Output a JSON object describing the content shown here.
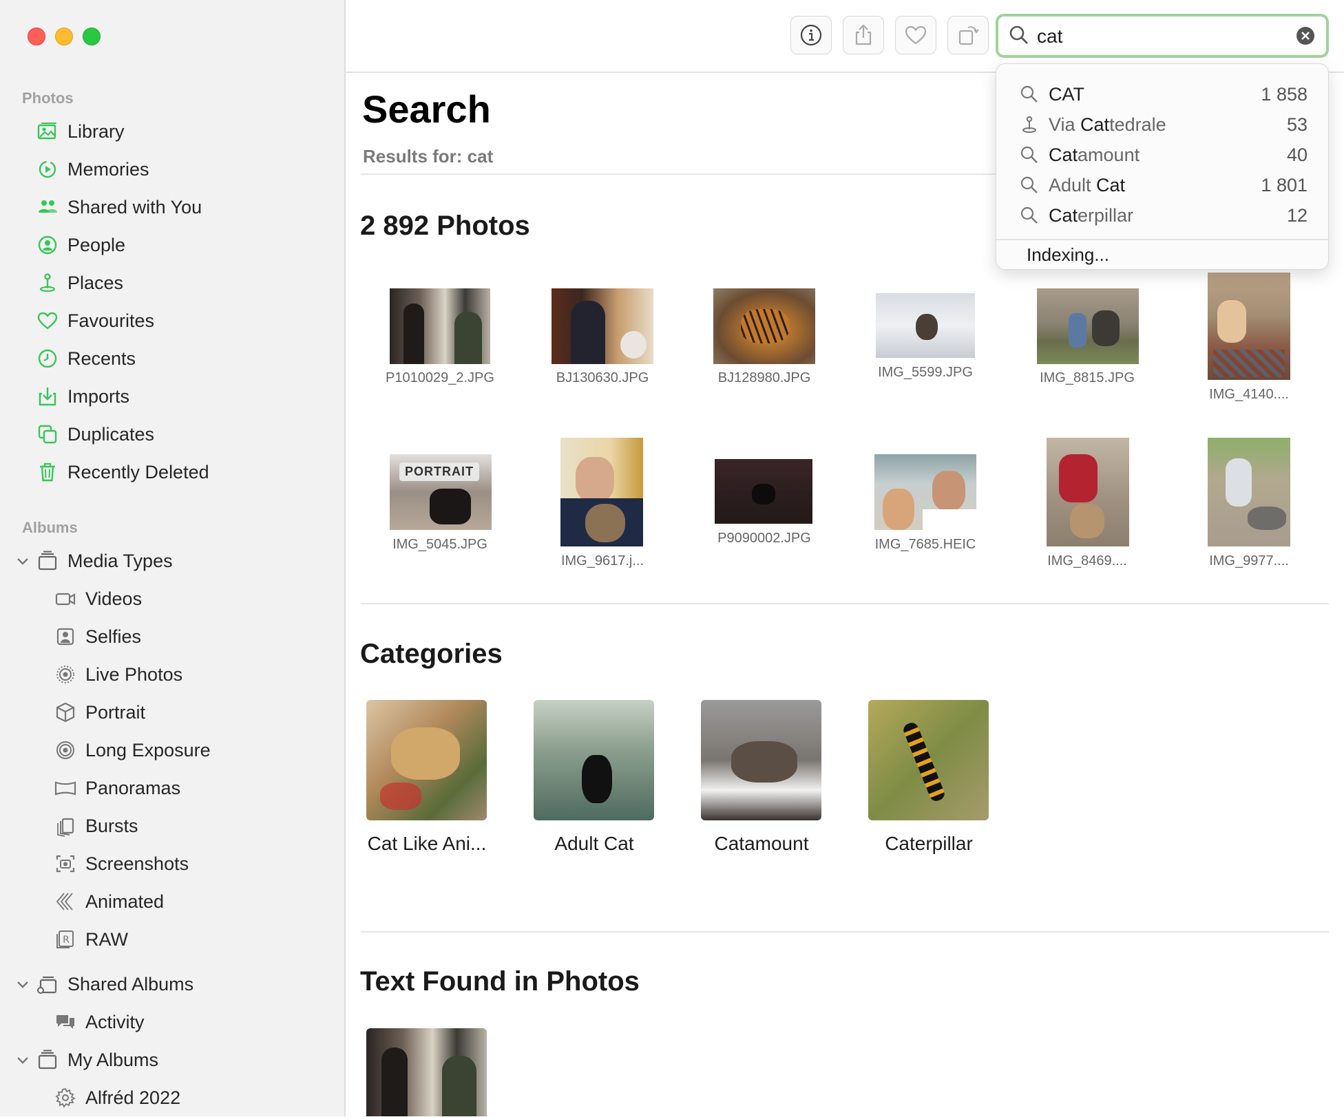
{
  "accent": "#34c759",
  "search_ring": "#9fd49a",
  "sidebar": {
    "section_photos": "Photos",
    "photos_items": [
      {
        "label": "Library",
        "icon": "library-icon"
      },
      {
        "label": "Memories",
        "icon": "memories-icon"
      },
      {
        "label": "Shared with You",
        "icon": "shared-with-you-icon"
      },
      {
        "label": "People",
        "icon": "people-icon"
      },
      {
        "label": "Places",
        "icon": "places-icon"
      },
      {
        "label": "Favourites",
        "icon": "heart-icon"
      },
      {
        "label": "Recents",
        "icon": "clock-icon"
      },
      {
        "label": "Imports",
        "icon": "import-icon"
      },
      {
        "label": "Duplicates",
        "icon": "duplicates-icon"
      },
      {
        "label": "Recently Deleted",
        "icon": "trash-icon"
      }
    ],
    "section_albums": "Albums",
    "media_types": "Media Types",
    "media_items": [
      {
        "label": "Videos",
        "icon": "video-icon"
      },
      {
        "label": "Selfies",
        "icon": "selfie-icon"
      },
      {
        "label": "Live Photos",
        "icon": "live-photo-icon"
      },
      {
        "label": "Portrait",
        "icon": "portrait-cube-icon"
      },
      {
        "label": "Long Exposure",
        "icon": "long-exposure-icon"
      },
      {
        "label": "Panoramas",
        "icon": "panorama-icon"
      },
      {
        "label": "Bursts",
        "icon": "bursts-icon"
      },
      {
        "label": "Screenshots",
        "icon": "screenshot-icon"
      },
      {
        "label": "Animated",
        "icon": "animated-icon"
      },
      {
        "label": "RAW",
        "icon": "raw-icon"
      }
    ],
    "shared_albums": "Shared Albums",
    "activity": "Activity",
    "my_albums": "My Albums",
    "alfred": "Alfréd 2022"
  },
  "search": {
    "value": "cat",
    "suggestions": [
      {
        "pre": "",
        "match": "CAT",
        "post": "",
        "count": "1 858",
        "icon": "search-icon"
      },
      {
        "pre": "Via ",
        "match": "Cat",
        "post": "tedrale",
        "count": "53",
        "icon": "places-icon"
      },
      {
        "pre": "",
        "match": "Cat",
        "post": "amount",
        "count": "40",
        "icon": "search-icon"
      },
      {
        "pre": "Adult ",
        "match": "Cat",
        "post": "",
        "count": "1 801",
        "icon": "search-icon"
      },
      {
        "pre": "",
        "match": "Cat",
        "post": "erpillar",
        "count": "12",
        "icon": "search-icon"
      }
    ],
    "indexing": "Indexing..."
  },
  "main": {
    "title": "Search",
    "results_for": "Results for: cat",
    "photos_heading": "2 892 Photos",
    "photos": [
      {
        "name": "P1010029_2.JPG"
      },
      {
        "name": "BJ130630.JPG"
      },
      {
        "name": "BJ128980.JPG"
      },
      {
        "name": "IMG_5599.JPG"
      },
      {
        "name": "IMG_8815.JPG"
      },
      {
        "name": "IMG_4140...."
      },
      {
        "name": "IMG_5045.JPG",
        "badge": "PORTRAIT"
      },
      {
        "name": "IMG_9617.j..."
      },
      {
        "name": "P9090002.JPG"
      },
      {
        "name": "IMG_7685.HEIC"
      },
      {
        "name": "IMG_8469...."
      },
      {
        "name": "IMG_9977...."
      }
    ],
    "categories_heading": "Categories",
    "categories": [
      "Cat Like Ani...",
      "Adult Cat",
      "Catamount",
      "Caterpillar"
    ],
    "text_found_heading": "Text Found in Photos"
  }
}
